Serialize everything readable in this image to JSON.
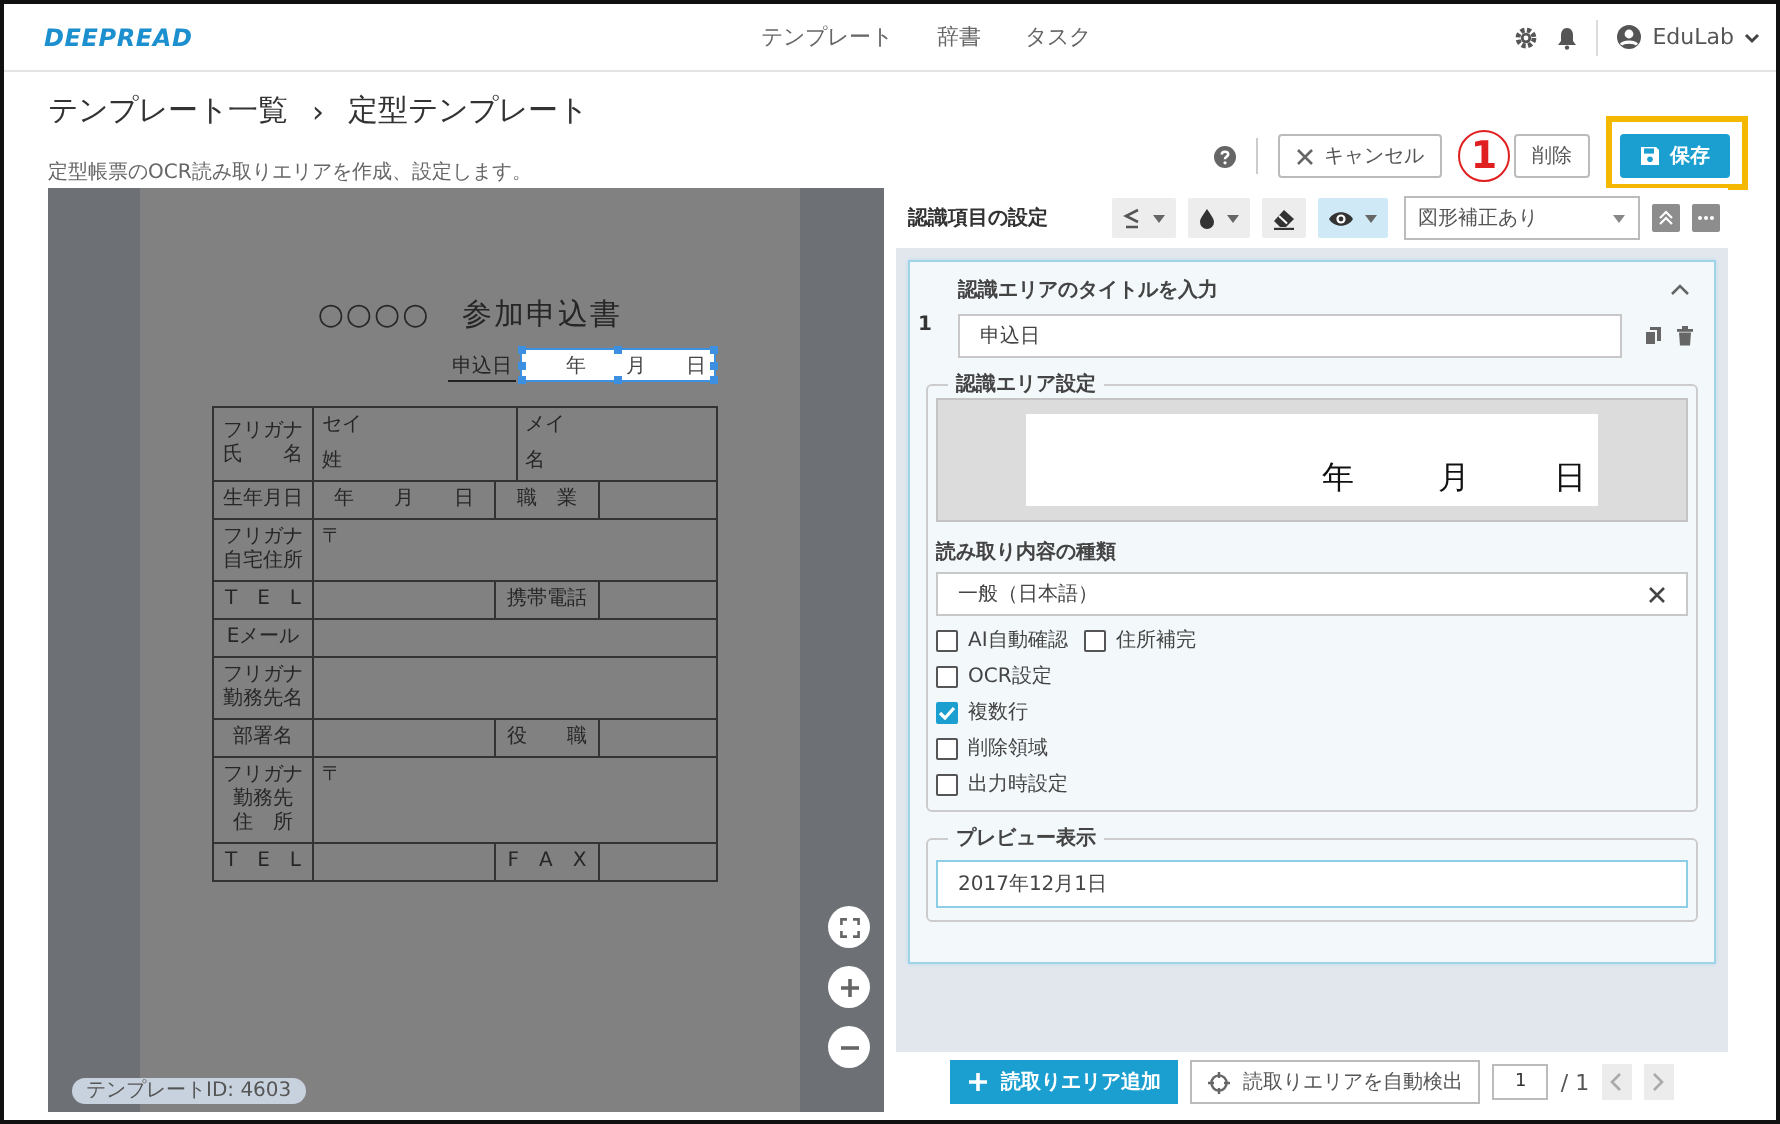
{
  "header": {
    "logo": "DEEPREAD",
    "nav": [
      {
        "label": "テンプレート"
      },
      {
        "label": "辞書"
      },
      {
        "label": "タスク"
      }
    ],
    "user": "EduLab"
  },
  "title_bar": {
    "breadcrumb": [
      {
        "label": "テンプレート一覧"
      },
      {
        "label": "定型テンプレート"
      }
    ],
    "separator": "›",
    "subtitle": "定型帳票のOCR読み取りエリアを作成、設定します。",
    "buttons": [
      {
        "kind": "cancel",
        "label": "キャンセル",
        "highlighted": false
      },
      {
        "kind": "delete",
        "label": "削除",
        "highlighted": false,
        "callout": "1"
      },
      {
        "kind": "save",
        "label": "保存",
        "highlighted": true
      }
    ]
  },
  "viewer": {
    "document": {
      "title": "○○○○　参加申込書",
      "date_label": "申込日",
      "date_marks": [
        "年",
        "月",
        "日"
      ],
      "rows": [
        {
          "kind": "name",
          "label": [
            "フリガナ",
            "氏　　名"
          ],
          "cells": [
            {
              "lines": [
                "セイ",
                "姓"
              ]
            },
            {
              "lines": [
                "メイ",
                "名"
              ]
            }
          ]
        },
        {
          "kind": "split",
          "label": [
            "生年月日"
          ],
          "value": "年　　月　　日",
          "label2": "職　業"
        },
        {
          "kind": "single",
          "label": [
            "フリガナ",
            "自宅住所"
          ],
          "value": "〒"
        },
        {
          "kind": "split",
          "label": [
            "T　E　L"
          ],
          "label2": "携帯電話"
        },
        {
          "kind": "single",
          "label": [
            "Eメール"
          ]
        },
        {
          "kind": "single",
          "label": [
            "フリガナ",
            "勤務先名"
          ]
        },
        {
          "kind": "split",
          "label": [
            "部署名"
          ],
          "label2": "役　　職"
        },
        {
          "kind": "single",
          "label": [
            "フリガナ",
            "勤務先",
            "住　所"
          ],
          "value": "〒"
        },
        {
          "kind": "split",
          "label": [
            "T　E　L"
          ],
          "label2": "F　A　X"
        }
      ]
    },
    "template_id": "テンプレートID: 4603"
  },
  "settings": {
    "title": "認識項目の設定",
    "tools": [
      {
        "kind": "align",
        "selected": false
      },
      {
        "kind": "ink",
        "selected": false
      },
      {
        "kind": "eraser",
        "selected": false
      },
      {
        "kind": "view",
        "selected": true
      }
    ],
    "correction": "図形補正あり",
    "items": [
      {
        "number": "1",
        "expanded": true,
        "title_label": "認識エリアのタイトルを入力",
        "title_value": "申込日",
        "area_label": "認識エリア設定",
        "area_marks": [
          "年",
          "月",
          "日"
        ],
        "type_label": "読み取り内容の種類",
        "type_value": "一般（日本語）",
        "option_rows": [
          [
            {
              "label": "AI自動確認",
              "checked": false
            },
            {
              "label": "住所補完",
              "checked": false
            }
          ],
          [
            {
              "label": "OCR設定",
              "checked": false
            }
          ],
          [
            {
              "label": "複数行",
              "checked": true
            }
          ],
          [
            {
              "label": "削除領域",
              "checked": false
            }
          ],
          [
            {
              "label": "出力時設定",
              "checked": false
            }
          ]
        ],
        "preview_label": "プレビュー表示",
        "preview_value": "2017年12月1日"
      }
    ]
  },
  "footer": {
    "add": "読取りエリア追加",
    "detect": "読取りエリアを自動検出",
    "page": "1",
    "total": "/ 1"
  }
}
